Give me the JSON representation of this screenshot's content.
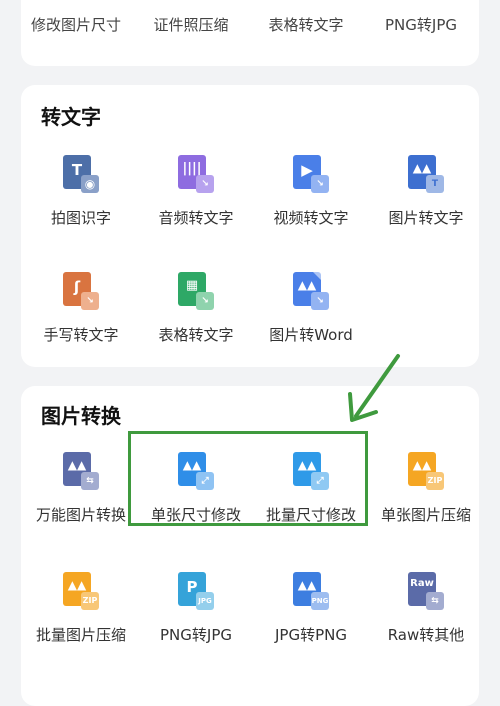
{
  "top_row": [
    "修改图片尺寸",
    "证件照压缩",
    "表格转文字",
    "PNG转JPG"
  ],
  "sections": {
    "text": {
      "title": "转文字",
      "tools": [
        {
          "label": "拍图识字",
          "icon": "photo-text-icon",
          "color": "#4d6fa8"
        },
        {
          "label": "音频转文字",
          "icon": "audio-to-text-icon",
          "color": "#8e6ce0"
        },
        {
          "label": "视频转文字",
          "icon": "video-to-text-icon",
          "color": "#4a7fe8"
        },
        {
          "label": "图片转文字",
          "icon": "image-to-text-icon",
          "color": "#3d6fd0"
        },
        {
          "label": "手写转文字",
          "icon": "handwriting-to-text-icon",
          "color": "#d97440"
        },
        {
          "label": "表格转文字",
          "icon": "table-to-text-icon",
          "color": "#2ea866"
        },
        {
          "label": "图片转Word",
          "icon": "image-to-word-icon",
          "color": "#4a7fe8"
        }
      ]
    },
    "image": {
      "title": "图片转换",
      "tools": [
        {
          "label": "万能图片转换",
          "icon": "universal-convert-icon",
          "color": "#5b6ba8"
        },
        {
          "label": "单张尺寸修改",
          "icon": "single-resize-icon",
          "color": "#2f8ee8"
        },
        {
          "label": "批量尺寸修改",
          "icon": "batch-resize-icon",
          "color": "#2f9ae8"
        },
        {
          "label": "单张图片压缩",
          "icon": "single-compress-icon",
          "color": "#f5a623"
        },
        {
          "label": "批量图片压缩",
          "icon": "batch-compress-icon",
          "color": "#f5a623"
        },
        {
          "label": "PNG转JPG",
          "icon": "png-to-jpg-icon",
          "color": "#35a3d9"
        },
        {
          "label": "JPG转PNG",
          "icon": "jpg-to-png-icon",
          "color": "#3d7ee0"
        },
        {
          "label": "Raw转其他",
          "icon": "raw-convert-icon",
          "color": "#5b6ba8"
        }
      ]
    }
  },
  "icon_glyphs": {
    "photo_text": "T",
    "image_text_badge": "T",
    "png_badge": "PNG",
    "jpg_badge": "JPG",
    "zip_badge": "ZIP",
    "raw_text": "Raw",
    "p_letter": "P"
  },
  "annotation_color": "#3f9a3e"
}
